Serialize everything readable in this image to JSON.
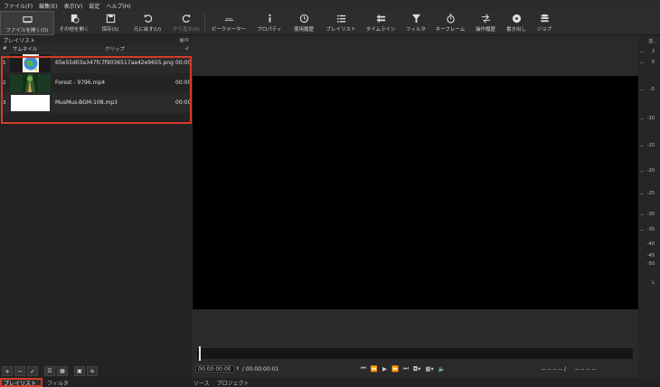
{
  "menu": [
    "ファイル(F)",
    "編集(E)",
    "表示(V)",
    "設定",
    "ヘルプ(H)"
  ],
  "toolbar": [
    {
      "label": "ファイルを開く(O)",
      "icon": "open-file-icon",
      "active": true
    },
    {
      "label": "その他を開く",
      "icon": "open-other-icon"
    },
    {
      "label": "保存(S)",
      "icon": "save-icon"
    },
    {
      "label": "元に戻す(U)",
      "icon": "undo-icon"
    },
    {
      "label": "やり直す(R)",
      "icon": "redo-icon",
      "dim": true
    },
    {
      "label": "ピークメーター",
      "icon": "peak-meter-icon"
    },
    {
      "label": "プロパティ",
      "icon": "info-icon"
    },
    {
      "label": "使用履歴",
      "icon": "history-icon"
    },
    {
      "label": "プレイリスト",
      "icon": "playlist-icon"
    },
    {
      "label": "タイムライン",
      "icon": "timeline-icon"
    },
    {
      "label": "フィルタ",
      "icon": "filter-icon"
    },
    {
      "label": "キーフレーム",
      "icon": "keyframe-icon"
    },
    {
      "label": "操作履歴",
      "icon": "action-history-icon"
    },
    {
      "label": "書き出し",
      "icon": "export-icon"
    },
    {
      "label": "ジョブ",
      "icon": "jobs-icon"
    }
  ],
  "playlist": {
    "title": "プレイリスト",
    "columns": [
      "#",
      "サムネイル",
      "クリップ",
      "イ"
    ],
    "items": [
      {
        "num": "1",
        "clip": "65e55d03a347fc7f9036517aa42e9655.png",
        "dur": "00:00"
      },
      {
        "num": "2",
        "clip": "Forest - 9796.mp4",
        "dur": "00:00"
      },
      {
        "num": "3",
        "clip": "MusMus-BGM-108.mp3",
        "dur": "00:00"
      }
    ]
  },
  "player": {
    "current_tc": "00:00:00:00",
    "total_tc": "/ 00:00:00:01",
    "in_point": "-- -- -- -- /",
    "out_point": "-- -- -- --"
  },
  "bottom_tabs": {
    "left": [
      "プレイリスト",
      "フィルタ"
    ],
    "right": [
      "ソース",
      "プロジェクト"
    ]
  },
  "meter": {
    "header": "音...",
    "labels": [
      "2",
      "0",
      "-5",
      "-10",
      "-15",
      "-20",
      "-25",
      "-30",
      "-35",
      "-40",
      "-45",
      "-50"
    ],
    "channel": "L"
  }
}
